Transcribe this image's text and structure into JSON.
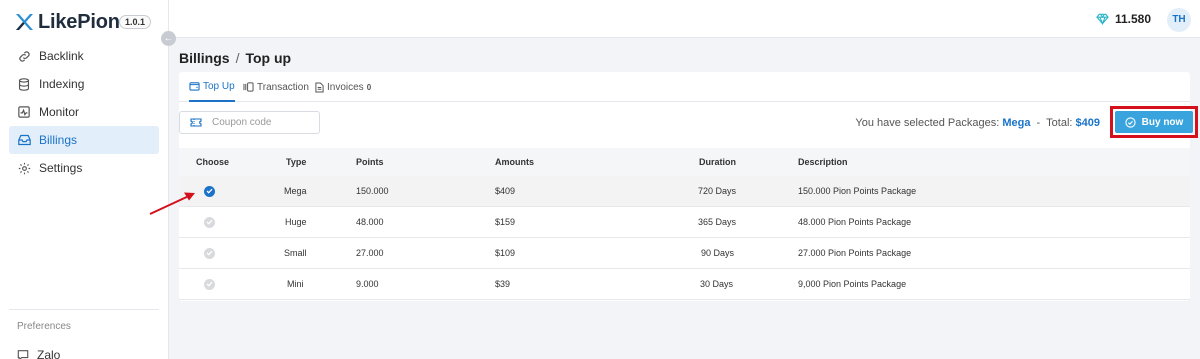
{
  "app": {
    "name": "LikePion",
    "version": "1.0.1"
  },
  "sidebar": {
    "items": [
      {
        "label": "Backlink",
        "icon": "link-icon"
      },
      {
        "label": "Indexing",
        "icon": "database-icon"
      },
      {
        "label": "Monitor",
        "icon": "monitor-icon"
      },
      {
        "label": "Billings",
        "icon": "inbox-icon",
        "active": true
      },
      {
        "label": "Settings",
        "icon": "gear-icon"
      }
    ],
    "preferences_label": "Preferences",
    "zalo_label": "Zalo"
  },
  "topbar": {
    "points": "11.580",
    "avatar_initials": "TH"
  },
  "breadcrumb": {
    "parent": "Billings",
    "separator": "/",
    "current": "Top up"
  },
  "tabs": [
    {
      "label": "Top Up",
      "active": true
    },
    {
      "label": "Transaction"
    },
    {
      "label": "Invoices",
      "badge": "0"
    }
  ],
  "coupon": {
    "placeholder": "Coupon code"
  },
  "selection": {
    "prefix": "You have selected Packages:",
    "package": "Mega",
    "dash": "-",
    "total_label": "Total:",
    "total_value": "$409"
  },
  "buy_button": {
    "label": "Buy now"
  },
  "table": {
    "headers": {
      "choose": "Choose",
      "type": "Type",
      "points": "Points",
      "amounts": "Amounts",
      "duration": "Duration",
      "description": "Description"
    },
    "rows": [
      {
        "type": "Mega",
        "points": "150.000",
        "amount": "$409",
        "duration": "720 Days",
        "description": "150.000 Pion Points Package",
        "selected": true
      },
      {
        "type": "Huge",
        "points": "48.000",
        "amount": "$159",
        "duration": "365 Days",
        "description": "48.000 Pion Points Package",
        "selected": false
      },
      {
        "type": "Small",
        "points": "27.000",
        "amount": "$109",
        "duration": "90 Days",
        "description": "27.000 Pion Points Package",
        "selected": false
      },
      {
        "type": "Mini",
        "points": "9.000",
        "amount": "$39",
        "duration": "30 Days",
        "description": "9,000 Pion Points Package",
        "selected": false
      }
    ]
  },
  "colors": {
    "accent": "#1a73c8",
    "buy_button": "#39a3de",
    "highlight_box": "#d3101b",
    "arrow": "#d3101b"
  }
}
